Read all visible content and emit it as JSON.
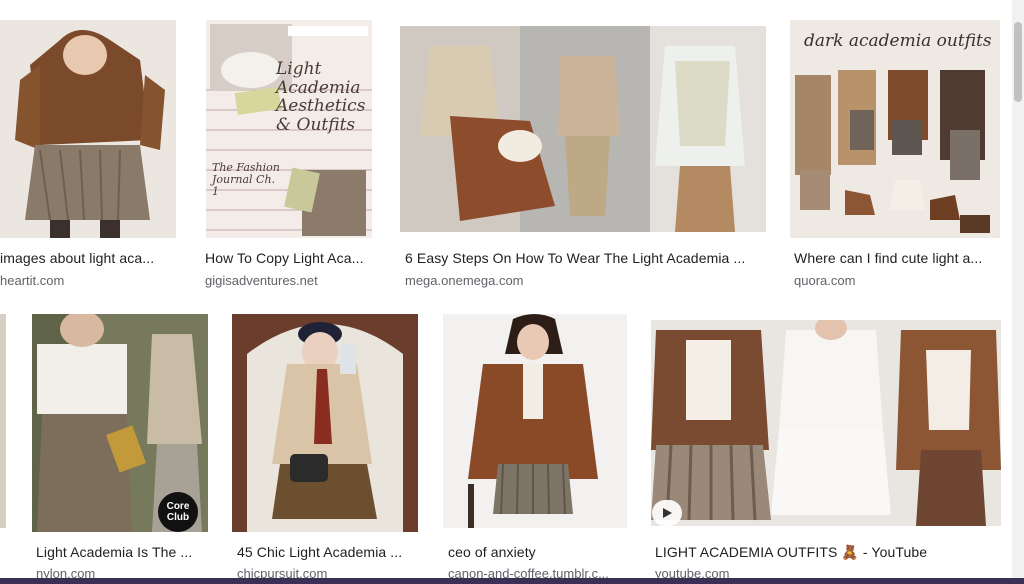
{
  "row1": [
    {
      "title": "images about light aca...",
      "source": "heartit.com"
    },
    {
      "title": "How To Copy Light Aca...",
      "source": "gigisadventures.net"
    },
    {
      "title": "6 Easy Steps On How To Wear The Light Academia ...",
      "source": "mega.onemega.com"
    },
    {
      "title": "Where can I find cute light a...",
      "source": "quora.com"
    }
  ],
  "row2": [
    {
      "title": "Light Academia Is The ...",
      "source": "nylon.com"
    },
    {
      "title": "45 Chic Light Academia ...",
      "source": "chicpursuit.com"
    },
    {
      "title": "ceo of anxiety",
      "source": "canon-and-coffee.tumblr.c..."
    },
    {
      "title": "LIGHT ACADEMIA OUTFITS 🧸 - YouTube",
      "source": "youtube.com"
    }
  ],
  "overlays": {
    "gigi_line1": "Light",
    "gigi_line2": "Academia",
    "gigi_line3": "Aesthetics",
    "gigi_line4": "& Outfits",
    "gigi_journal": "The Fashion Journal Ch. 1",
    "quora_heading": "dark academia outfits",
    "nylon_badge": "Core Club"
  },
  "colors": {
    "title": "#202124",
    "source": "#5f6368",
    "accent_brown": "#7a4a2a"
  }
}
